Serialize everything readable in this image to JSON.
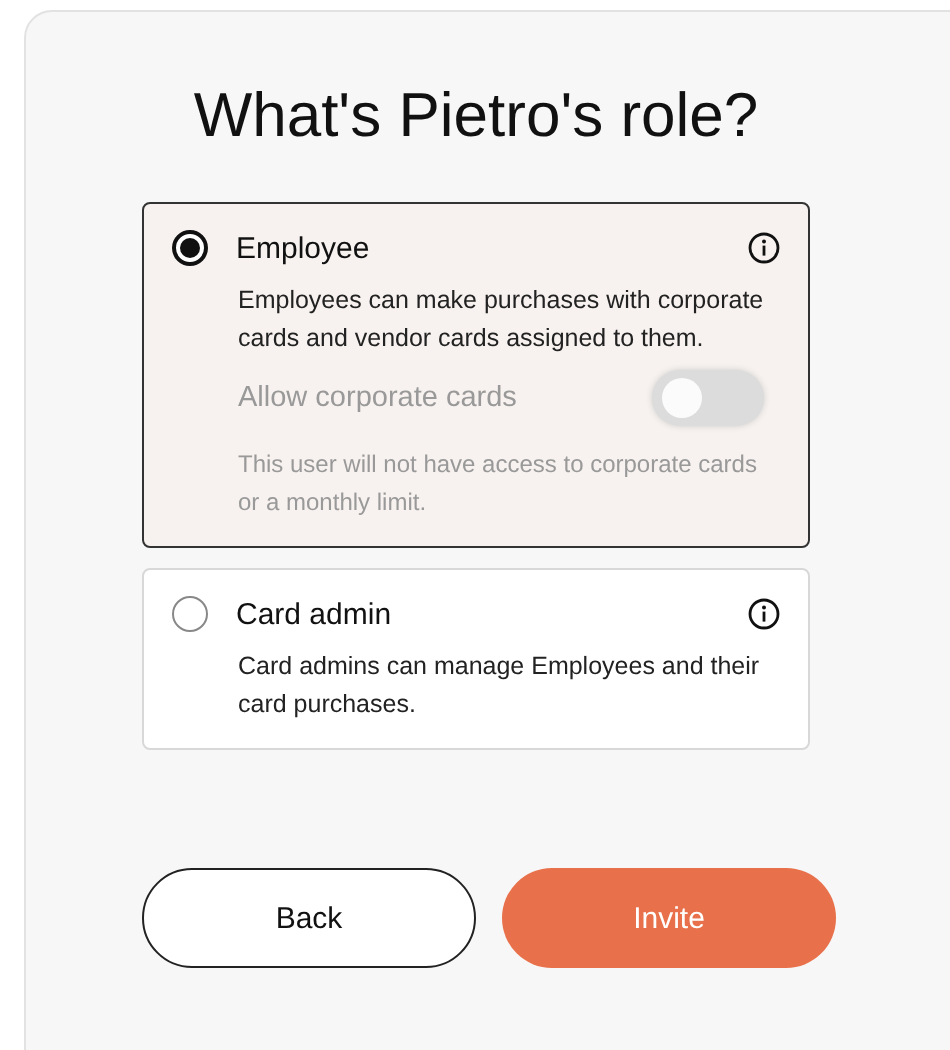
{
  "title": "What's Pietro's role?",
  "roles": [
    {
      "name": "Employee",
      "description": "Employees can make purchases with corporate cards and vendor cards assigned to them.",
      "selected": true,
      "toggle": {
        "label": "Allow corporate cards",
        "on": false,
        "disabled": true
      },
      "note": "This user will not have access to corporate cards or a monthly limit."
    },
    {
      "name": "Card admin",
      "description": "Card admins can manage Employees and their card purchases.",
      "selected": false
    }
  ],
  "buttons": [
    {
      "label": "Back",
      "kind": "secondary"
    },
    {
      "label": "Invite",
      "kind": "primary"
    }
  ]
}
